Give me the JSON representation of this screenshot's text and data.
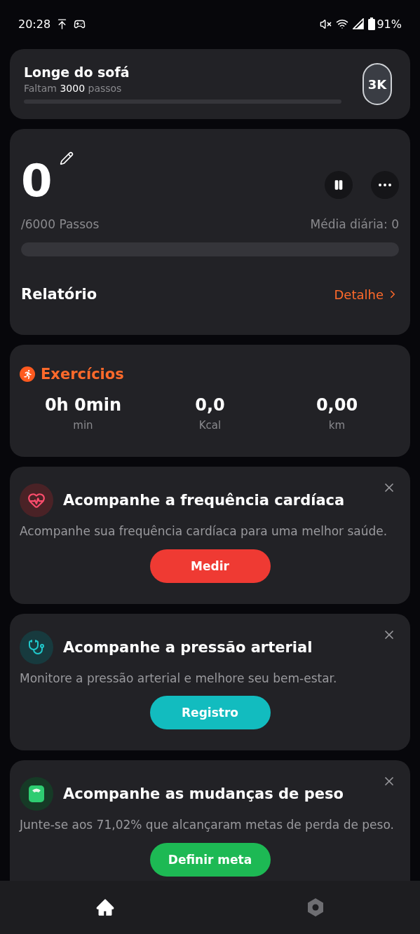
{
  "status_bar": {
    "time": "20:28",
    "battery": "91%"
  },
  "goal_card": {
    "title": "Longe do sofá",
    "subtitle": "Faltam **3000** passos",
    "level": 0,
    "badge": "3K"
  },
  "steps_card": {
    "count": "0",
    "goal": "/6000 Passos",
    "average": "Média diária: 0",
    "level": 0,
    "report": "Relatório",
    "detail": "Detalhe"
  },
  "exercise_card": {
    "title": "Exercícios",
    "stats": [
      {
        "value": "0h 0min",
        "unit": "min"
      },
      {
        "value": "0,0",
        "unit": "Kcal"
      },
      {
        "value": "0,00",
        "unit": "km"
      }
    ]
  },
  "promo_cards": [
    {
      "kind": "heart",
      "title": "Acompanhe a frequência cardíaca",
      "text": "Acompanhe sua frequência cardíaca para uma melhor saúde.",
      "button": "Medir",
      "color": "#ef3a33"
    },
    {
      "kind": "pressure",
      "title": "Acompanhe a pressão arterial",
      "text": "Monitore a pressão arterial e melhore seu bem-estar.",
      "button": "Registro",
      "color": "#12bcbf"
    },
    {
      "kind": "weight",
      "title": "Acompanhe as mudanças de peso",
      "text": "Junte-se aos 71,02% que alcançaram metas de perda de peso.",
      "button": "Definir meta",
      "color": "#1db954"
    }
  ],
  "bottom_nav": [
    {
      "kind": "home",
      "selected": true
    },
    {
      "kind": "settings",
      "selected": false
    }
  ]
}
